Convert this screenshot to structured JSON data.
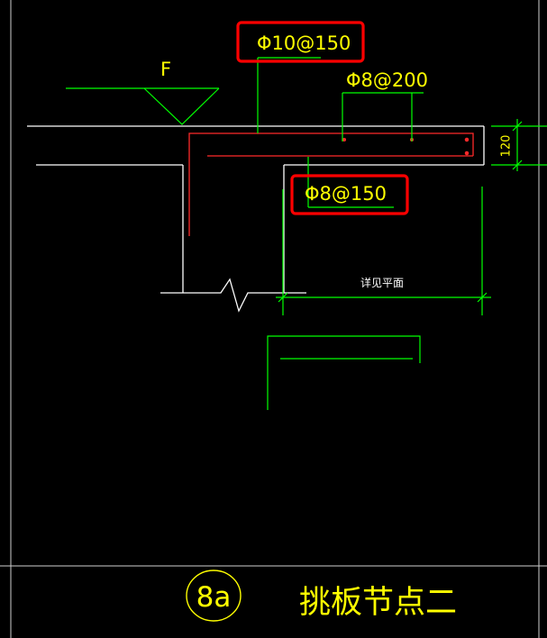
{
  "drawing": {
    "finish_label": "F",
    "top_rebar": "Φ10@150",
    "distribution_rebar": "Φ8@200",
    "bottom_rebar": "Φ8@150",
    "slab_thickness": "120",
    "span_note": "详见平面",
    "detail_number": "8a",
    "detail_title": "挑板节点二"
  },
  "colors": {
    "background": "#000000",
    "concrete_outline": "#ffffff",
    "rebar": "#ff2a2a",
    "leader": "#00ff00",
    "text": "#ffff00",
    "highlight_box": "#ff0000",
    "frame": "#cccccc"
  }
}
